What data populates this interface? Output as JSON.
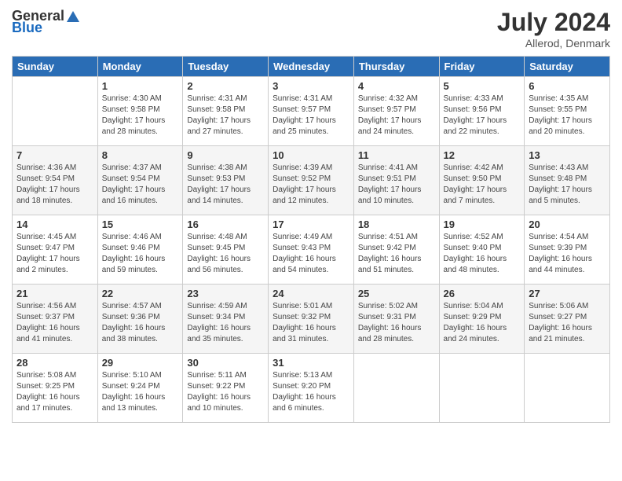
{
  "header": {
    "logo_general": "General",
    "logo_blue": "Blue",
    "month_year": "July 2024",
    "location": "Allerod, Denmark"
  },
  "days_of_week": [
    "Sunday",
    "Monday",
    "Tuesday",
    "Wednesday",
    "Thursday",
    "Friday",
    "Saturday"
  ],
  "weeks": [
    [
      {
        "day": "",
        "info": ""
      },
      {
        "day": "1",
        "info": "Sunrise: 4:30 AM\nSunset: 9:58 PM\nDaylight: 17 hours\nand 28 minutes."
      },
      {
        "day": "2",
        "info": "Sunrise: 4:31 AM\nSunset: 9:58 PM\nDaylight: 17 hours\nand 27 minutes."
      },
      {
        "day": "3",
        "info": "Sunrise: 4:31 AM\nSunset: 9:57 PM\nDaylight: 17 hours\nand 25 minutes."
      },
      {
        "day": "4",
        "info": "Sunrise: 4:32 AM\nSunset: 9:57 PM\nDaylight: 17 hours\nand 24 minutes."
      },
      {
        "day": "5",
        "info": "Sunrise: 4:33 AM\nSunset: 9:56 PM\nDaylight: 17 hours\nand 22 minutes."
      },
      {
        "day": "6",
        "info": "Sunrise: 4:35 AM\nSunset: 9:55 PM\nDaylight: 17 hours\nand 20 minutes."
      }
    ],
    [
      {
        "day": "7",
        "info": "Sunrise: 4:36 AM\nSunset: 9:54 PM\nDaylight: 17 hours\nand 18 minutes."
      },
      {
        "day": "8",
        "info": "Sunrise: 4:37 AM\nSunset: 9:54 PM\nDaylight: 17 hours\nand 16 minutes."
      },
      {
        "day": "9",
        "info": "Sunrise: 4:38 AM\nSunset: 9:53 PM\nDaylight: 17 hours\nand 14 minutes."
      },
      {
        "day": "10",
        "info": "Sunrise: 4:39 AM\nSunset: 9:52 PM\nDaylight: 17 hours\nand 12 minutes."
      },
      {
        "day": "11",
        "info": "Sunrise: 4:41 AM\nSunset: 9:51 PM\nDaylight: 17 hours\nand 10 minutes."
      },
      {
        "day": "12",
        "info": "Sunrise: 4:42 AM\nSunset: 9:50 PM\nDaylight: 17 hours\nand 7 minutes."
      },
      {
        "day": "13",
        "info": "Sunrise: 4:43 AM\nSunset: 9:48 PM\nDaylight: 17 hours\nand 5 minutes."
      }
    ],
    [
      {
        "day": "14",
        "info": "Sunrise: 4:45 AM\nSunset: 9:47 PM\nDaylight: 17 hours\nand 2 minutes."
      },
      {
        "day": "15",
        "info": "Sunrise: 4:46 AM\nSunset: 9:46 PM\nDaylight: 16 hours\nand 59 minutes."
      },
      {
        "day": "16",
        "info": "Sunrise: 4:48 AM\nSunset: 9:45 PM\nDaylight: 16 hours\nand 56 minutes."
      },
      {
        "day": "17",
        "info": "Sunrise: 4:49 AM\nSunset: 9:43 PM\nDaylight: 16 hours\nand 54 minutes."
      },
      {
        "day": "18",
        "info": "Sunrise: 4:51 AM\nSunset: 9:42 PM\nDaylight: 16 hours\nand 51 minutes."
      },
      {
        "day": "19",
        "info": "Sunrise: 4:52 AM\nSunset: 9:40 PM\nDaylight: 16 hours\nand 48 minutes."
      },
      {
        "day": "20",
        "info": "Sunrise: 4:54 AM\nSunset: 9:39 PM\nDaylight: 16 hours\nand 44 minutes."
      }
    ],
    [
      {
        "day": "21",
        "info": "Sunrise: 4:56 AM\nSunset: 9:37 PM\nDaylight: 16 hours\nand 41 minutes."
      },
      {
        "day": "22",
        "info": "Sunrise: 4:57 AM\nSunset: 9:36 PM\nDaylight: 16 hours\nand 38 minutes."
      },
      {
        "day": "23",
        "info": "Sunrise: 4:59 AM\nSunset: 9:34 PM\nDaylight: 16 hours\nand 35 minutes."
      },
      {
        "day": "24",
        "info": "Sunrise: 5:01 AM\nSunset: 9:32 PM\nDaylight: 16 hours\nand 31 minutes."
      },
      {
        "day": "25",
        "info": "Sunrise: 5:02 AM\nSunset: 9:31 PM\nDaylight: 16 hours\nand 28 minutes."
      },
      {
        "day": "26",
        "info": "Sunrise: 5:04 AM\nSunset: 9:29 PM\nDaylight: 16 hours\nand 24 minutes."
      },
      {
        "day": "27",
        "info": "Sunrise: 5:06 AM\nSunset: 9:27 PM\nDaylight: 16 hours\nand 21 minutes."
      }
    ],
    [
      {
        "day": "28",
        "info": "Sunrise: 5:08 AM\nSunset: 9:25 PM\nDaylight: 16 hours\nand 17 minutes."
      },
      {
        "day": "29",
        "info": "Sunrise: 5:10 AM\nSunset: 9:24 PM\nDaylight: 16 hours\nand 13 minutes."
      },
      {
        "day": "30",
        "info": "Sunrise: 5:11 AM\nSunset: 9:22 PM\nDaylight: 16 hours\nand 10 minutes."
      },
      {
        "day": "31",
        "info": "Sunrise: 5:13 AM\nSunset: 9:20 PM\nDaylight: 16 hours\nand 6 minutes."
      },
      {
        "day": "",
        "info": ""
      },
      {
        "day": "",
        "info": ""
      },
      {
        "day": "",
        "info": ""
      }
    ]
  ]
}
